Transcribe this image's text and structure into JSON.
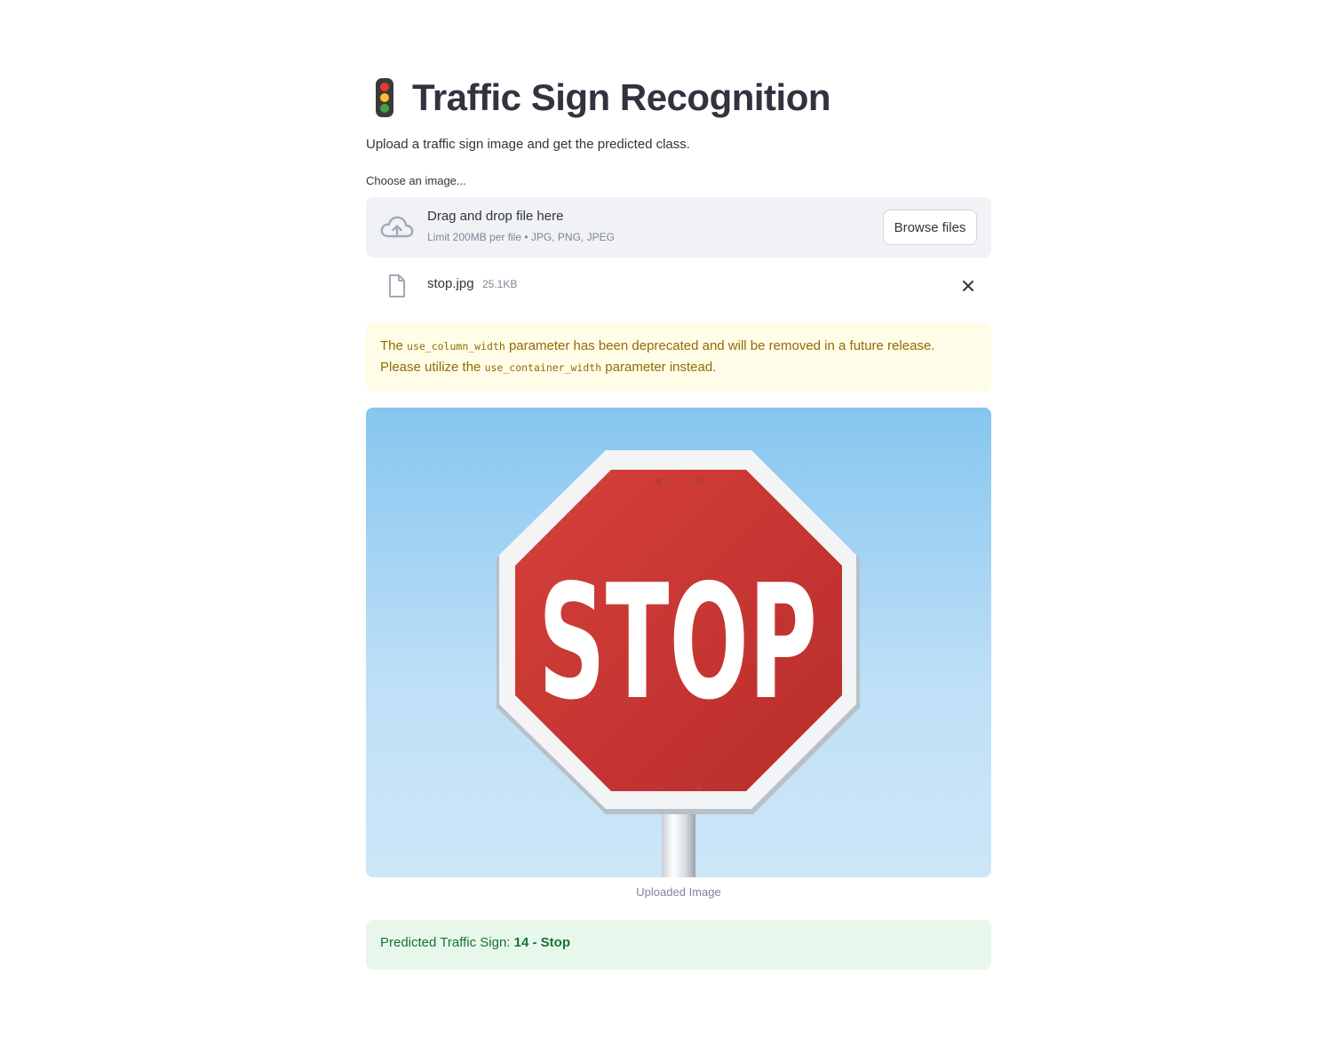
{
  "header": {
    "title": "Traffic Sign Recognition",
    "title_icon": "traffic-light-icon",
    "subtitle": "Upload a traffic sign image and get the predicted class."
  },
  "uploader": {
    "label": "Choose an image...",
    "dropzone_title": "Drag and drop file here",
    "dropzone_limit": "Limit 200MB per file • JPG, PNG, JPEG",
    "browse_label": "Browse files",
    "upload_icon": "cloud-upload-icon"
  },
  "file": {
    "name": "stop.jpg",
    "size": "25.1KB",
    "icon": "file-icon",
    "remove_icon": "close-icon"
  },
  "warning": {
    "text_1": "The ",
    "code_1": "use_column_width",
    "text_2": " parameter has been deprecated and will be removed in a future release. Please utilize the ",
    "code_2": "use_container_width",
    "text_3": " parameter instead."
  },
  "image": {
    "sign_text": "STOP",
    "caption": "Uploaded Image"
  },
  "result": {
    "label": "Predicted Traffic Sign: ",
    "value": "14 - Stop"
  },
  "colors": {
    "warning_bg": "#fffce7",
    "warning_text": "#926c05",
    "success_bg": "#e8f7ec",
    "success_text": "#177233",
    "dropzone_bg": "#f0f2f6",
    "sign_red": "#c9302c"
  }
}
